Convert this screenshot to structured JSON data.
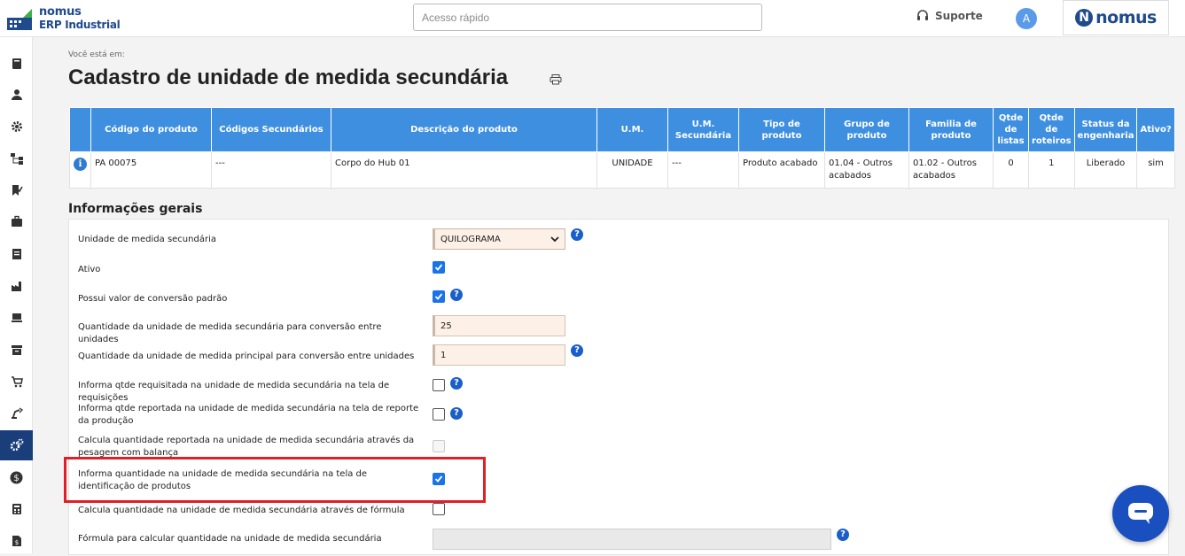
{
  "app": {
    "logo_line1": "nomus",
    "logo_line2": "ERP Industrial",
    "brand": "nomus"
  },
  "search": {
    "placeholder": "Acesso rápido"
  },
  "header": {
    "support_label": "Suporte",
    "avatar_initial": "A"
  },
  "sidebar": {
    "items": [
      {
        "icon": "book-icon"
      },
      {
        "icon": "user-icon"
      },
      {
        "icon": "gear-icon"
      },
      {
        "icon": "flow-icon"
      },
      {
        "icon": "bookmark-check-icon"
      },
      {
        "icon": "briefcase-icon"
      },
      {
        "icon": "report-icon"
      },
      {
        "icon": "factory-icon"
      },
      {
        "icon": "pallet-icon"
      },
      {
        "icon": "archive-icon"
      },
      {
        "icon": "cart-icon"
      },
      {
        "icon": "robot-arm-icon"
      },
      {
        "icon": "settings-active-icon",
        "active": true
      },
      {
        "icon": "dollar-icon"
      },
      {
        "icon": "calculator-icon"
      },
      {
        "icon": "document-dollar-icon"
      }
    ]
  },
  "page": {
    "breadcrumb": "Você está em:",
    "title": "Cadastro de unidade de medida secundária"
  },
  "product_table": {
    "headers": [
      "",
      "Código do produto",
      "Códigos Secundários",
      "Descrição do produto",
      "U.M.",
      "U.M. Secundária",
      "Tipo de produto",
      "Grupo de produto",
      "Familia de produto",
      "Qtde de listas",
      "Qtde de roteiros",
      "Status da engenharia",
      "Ativo?"
    ],
    "row": [
      "",
      "PA 00075",
      "---",
      "Corpo do Hub 01",
      "UNIDADE",
      "---",
      "Produto acabado",
      "01.04 - Outros acabados",
      "01.02 - Outros acabados",
      "0",
      "1",
      "Liberado",
      "sim"
    ]
  },
  "section": {
    "title": "Informações gerais"
  },
  "form": {
    "unit_label": "Unidade de medida secundária",
    "unit_value": "QUILOGRAMA",
    "ativo_label": "Ativo",
    "possui_label": "Possui valor de conversão padrão",
    "qtd_sec_label": "Quantidade da unidade de medida secundária para conversão entre unidades",
    "qtd_sec_value": "25",
    "qtd_pri_label": "Quantidade da unidade de medida principal para conversão entre unidades",
    "qtd_pri_value": "1",
    "req_label": "Informa qtde requisitada na unidade de medida secundária na tela de requisições",
    "rep_label": "Informa qtde reportada na unidade de medida secundária na tela de reporte da produção",
    "bal_label": "Calcula quantidade reportada na unidade de medida secundária através da pesagem com balança",
    "ident_label": "Informa quantidade na unidade de medida secundária na tela de identificação de produtos",
    "form_calc_label": "Calcula quantidade na unidade de medida secundária através de fórmula",
    "formula_label": "Fórmula para calcular quantidade na unidade de medida secundária",
    "formula_value": ""
  },
  "colors": {
    "accent": "#3f8fe0",
    "highlight": "#e01f26",
    "sidebar_active": "#1a3e7a"
  }
}
